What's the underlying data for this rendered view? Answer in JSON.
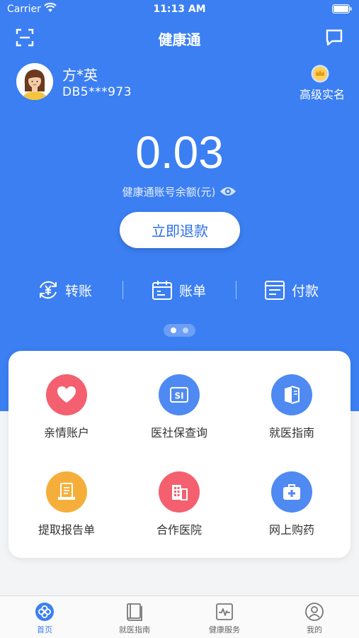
{
  "status_bar": {
    "carrier": "Carrier",
    "time": "11:13 AM"
  },
  "nav": {
    "title": "健康通"
  },
  "user": {
    "name": "方*英",
    "id": "DB5***973",
    "verification": "高级实名"
  },
  "balance": {
    "value": "0.03",
    "label": "健康通账号余额(元)"
  },
  "refund_button": "立即退款",
  "actions": [
    {
      "label": "转账",
      "icon": "yuan-transfer-icon"
    },
    {
      "label": "账单",
      "icon": "calendar-bill-icon"
    },
    {
      "label": "付款",
      "icon": "payment-card-icon"
    }
  ],
  "pager": {
    "pages": 2,
    "active": 1
  },
  "services": [
    {
      "label": "亲情账户",
      "icon": "heart-icon",
      "color": "#f4606f"
    },
    {
      "label": "医社保查询",
      "icon": "si-card-icon",
      "color": "#4f8af3"
    },
    {
      "label": "就医指南",
      "icon": "guide-book-icon",
      "color": "#4f8af3"
    },
    {
      "label": "提取报告单",
      "icon": "report-icon",
      "color": "#f6ae3a"
    },
    {
      "label": "合作医院",
      "icon": "hospital-icon",
      "color": "#f4606f"
    },
    {
      "label": "网上购药",
      "icon": "medical-kit-icon",
      "color": "#4f8af3"
    }
  ],
  "tabs": [
    {
      "label": "首页",
      "icon": "home-icon",
      "active": true
    },
    {
      "label": "就医指南",
      "icon": "book-icon",
      "active": false
    },
    {
      "label": "健康服务",
      "icon": "pulse-icon",
      "active": false
    },
    {
      "label": "我的",
      "icon": "profile-icon",
      "active": false
    }
  ],
  "colors": {
    "primary": "#3b7ff2",
    "background": "#f3f4f6",
    "accent_red": "#f4606f",
    "accent_orange": "#f6ae3a"
  }
}
